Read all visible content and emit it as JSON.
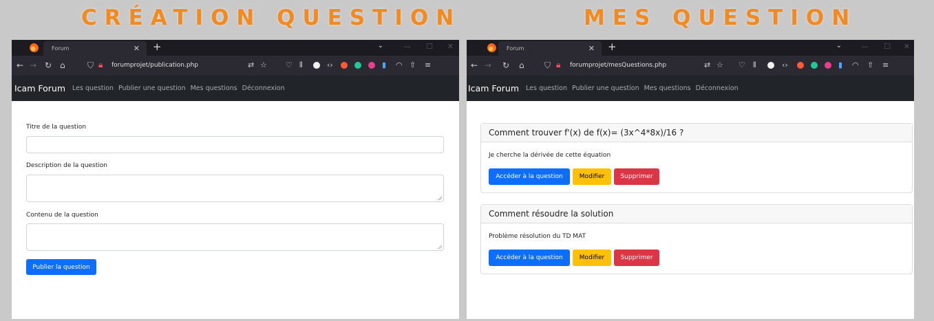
{
  "headings": {
    "left": "CRÉATION QUESTION",
    "right": "MES QUESTION"
  },
  "colors": {
    "heading": "#f28a1f",
    "navbar": "#212529",
    "primary": "#0d6efd",
    "warning": "#ffc107",
    "danger": "#dc3545"
  },
  "left_window": {
    "tab_title": "Forum",
    "url": "forumprojet/publication.php",
    "navbar": {
      "brand": "Icam Forum",
      "links": [
        "Les question",
        "Publier une question",
        "Mes questions",
        "Déconnexion"
      ]
    },
    "form": {
      "title_label": "Titre de la question",
      "description_label": "Description de la question",
      "content_label": "Contenu de la question",
      "submit_label": "Publier la question"
    }
  },
  "right_window": {
    "tab_title": "Forum",
    "url": "forumprojet/mesQuestions.php",
    "navbar": {
      "brand": "Icam Forum",
      "links": [
        "Les question",
        "Publier une question",
        "Mes questions",
        "Déconnexion"
      ]
    },
    "questions": [
      {
        "title": "Comment trouver f'(x) de f(x)= (3x^4*8x)/16 ?",
        "description": "Je cherche la dérivée de cette équation",
        "access_label": "Accéder à la question",
        "edit_label": "Modifier",
        "delete_label": "Supprimer"
      },
      {
        "title": "Comment résoudre la solution",
        "description": "Problème résolution du TD MAT",
        "access_label": "Accéder à la question",
        "edit_label": "Modifier",
        "delete_label": "Supprimer"
      }
    ]
  },
  "icons": [
    "firefox-icon",
    "close-icon",
    "plus-icon",
    "chevron-down-icon",
    "back-icon",
    "forward-icon",
    "reload-icon",
    "home-icon",
    "shield-icon",
    "lock-icon",
    "translate-icon",
    "star-icon",
    "pocket-icon",
    "library-icon",
    "extensions-icon",
    "account-icon",
    "menu-icon"
  ]
}
